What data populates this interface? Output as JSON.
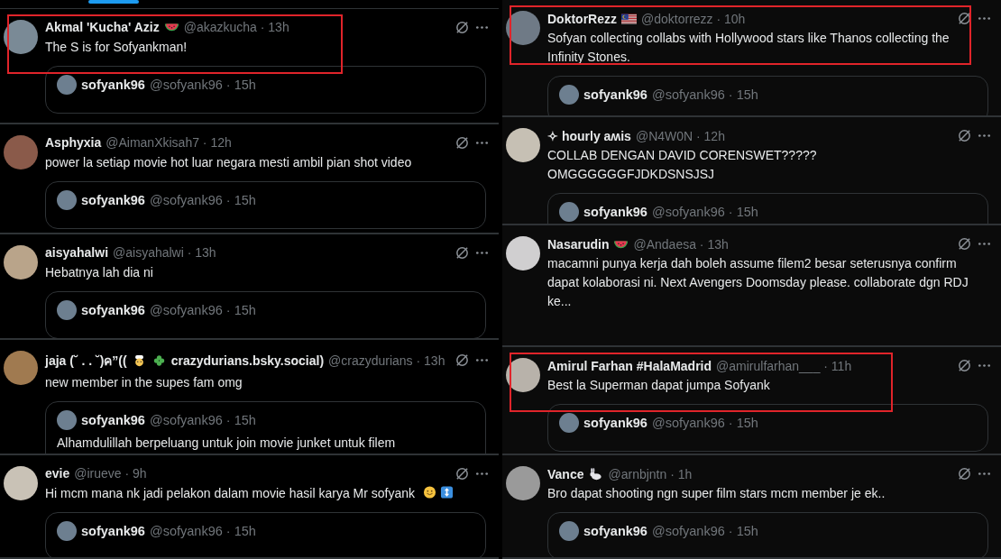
{
  "columns": [
    {
      "tweets": [
        {
          "name_parts": [
            {
              "kind": "text",
              "text": "Akmal 'Kucha' Aziz"
            },
            {
              "kind": "watermelon"
            }
          ],
          "handle_time": "@akazkucha · 13h",
          "body": "The S is for Sofyankman!",
          "highlighted": true,
          "quote": {
            "name": "sofyank96",
            "handle_time": "@sofyank96 · 15h"
          }
        },
        {
          "name_parts": [
            {
              "kind": "text",
              "text": "Asphyxia"
            }
          ],
          "handle_time": "@AimanXkisah7 · 12h",
          "body": "power la setiap movie hot luar negara mesti ambil pian shot video",
          "highlighted": false,
          "quote": {
            "name": "sofyank96",
            "handle_time": "@sofyank96 · 15h"
          }
        },
        {
          "name_parts": [
            {
              "kind": "text",
              "text": "aisyahalwi"
            }
          ],
          "handle_time": "@aisyahalwi · 13h",
          "body": "Hebatnya lah dia ni",
          "highlighted": false,
          "quote": {
            "name": "sofyank96",
            "handle_time": "@sofyank96 · 15h"
          }
        },
        {
          "name_parts": [
            {
              "kind": "text",
              "text": "jaja (˘ . . ˘)ค”(("
            },
            {
              "kind": "cook"
            },
            {
              "kind": "clover"
            },
            {
              "kind": "text",
              "text": "crazydurians.bsky.social)"
            }
          ],
          "handle_time": "@crazydurians · 13h",
          "body": "new member in the supes fam omg",
          "highlighted": false,
          "quote": {
            "name": "sofyank96",
            "handle_time": "@sofyank96 · 15h",
            "text": "Alhamdulillah berpeluang untuk join movie junket untuk filem"
          }
        },
        {
          "name_parts": [
            {
              "kind": "text",
              "text": "evie"
            }
          ],
          "handle_time": "@irueve · 9h",
          "body": "Hi mcm mana nk jadi pelakon dalam movie hasil karya Mr sofyank",
          "body_icons": [
            {
              "kind": "smiley"
            },
            {
              "kind": "updown"
            }
          ],
          "highlighted": false,
          "quote": {
            "name": "sofyank96",
            "handle_time": "@sofyank96 · 15h"
          }
        }
      ]
    },
    {
      "tweets": [
        {
          "name_parts": [
            {
              "kind": "text",
              "text": "DoktorRezz"
            },
            {
              "kind": "flag"
            }
          ],
          "handle_time": "@doktorrezz · 10h",
          "body": "Sofyan collecting collabs with Hollywood stars like Thanos collecting the Infinity Stones.",
          "highlighted": true,
          "quote": {
            "name": "sofyank96",
            "handle_time": "@sofyank96 · 15h"
          }
        },
        {
          "name_parts": [
            {
              "kind": "text",
              "text": "✧ hourly aʍis"
            }
          ],
          "handle_time": "@N4W0N · 12h",
          "body": "COLLAB DENGAN DAVID CORENSWET????? OMGGGGGGFJDKDSNSJSJ",
          "highlighted": false,
          "quote": {
            "name": "sofyank96",
            "handle_time": "@sofyank96 · 15h"
          }
        },
        {
          "name_parts": [
            {
              "kind": "text",
              "text": "Nasarudin"
            },
            {
              "kind": "watermelon"
            }
          ],
          "handle_time": "@Andaesa · 13h",
          "body": "macamni punya kerja dah boleh assume filem2 besar seterusnya confirm dapat kolaborasi ni. Next Avengers Doomsday please. collaborate dgn RDJ ke...",
          "highlighted": false
        },
        {
          "name_parts": [
            {
              "kind": "text",
              "text": "Amirul Farhan #HalaMadrid"
            }
          ],
          "handle_time": "@amirulfarhan___ · 11h",
          "body": "Best la Superman dapat jumpa Sofyank",
          "highlighted": true,
          "quote": {
            "name": "sofyank96",
            "handle_time": "@sofyank96 · 15h"
          }
        },
        {
          "name_parts": [
            {
              "kind": "text",
              "text": "Vance"
            },
            {
              "kind": "rabbit"
            }
          ],
          "handle_time": "@arnbjntn · 1h",
          "body": "Bro dapat shooting ngn super film stars mcm member je ek..",
          "highlighted": false,
          "quote": {
            "name": "sofyank96",
            "handle_time": "@sofyank96 · 15h"
          }
        }
      ]
    }
  ]
}
